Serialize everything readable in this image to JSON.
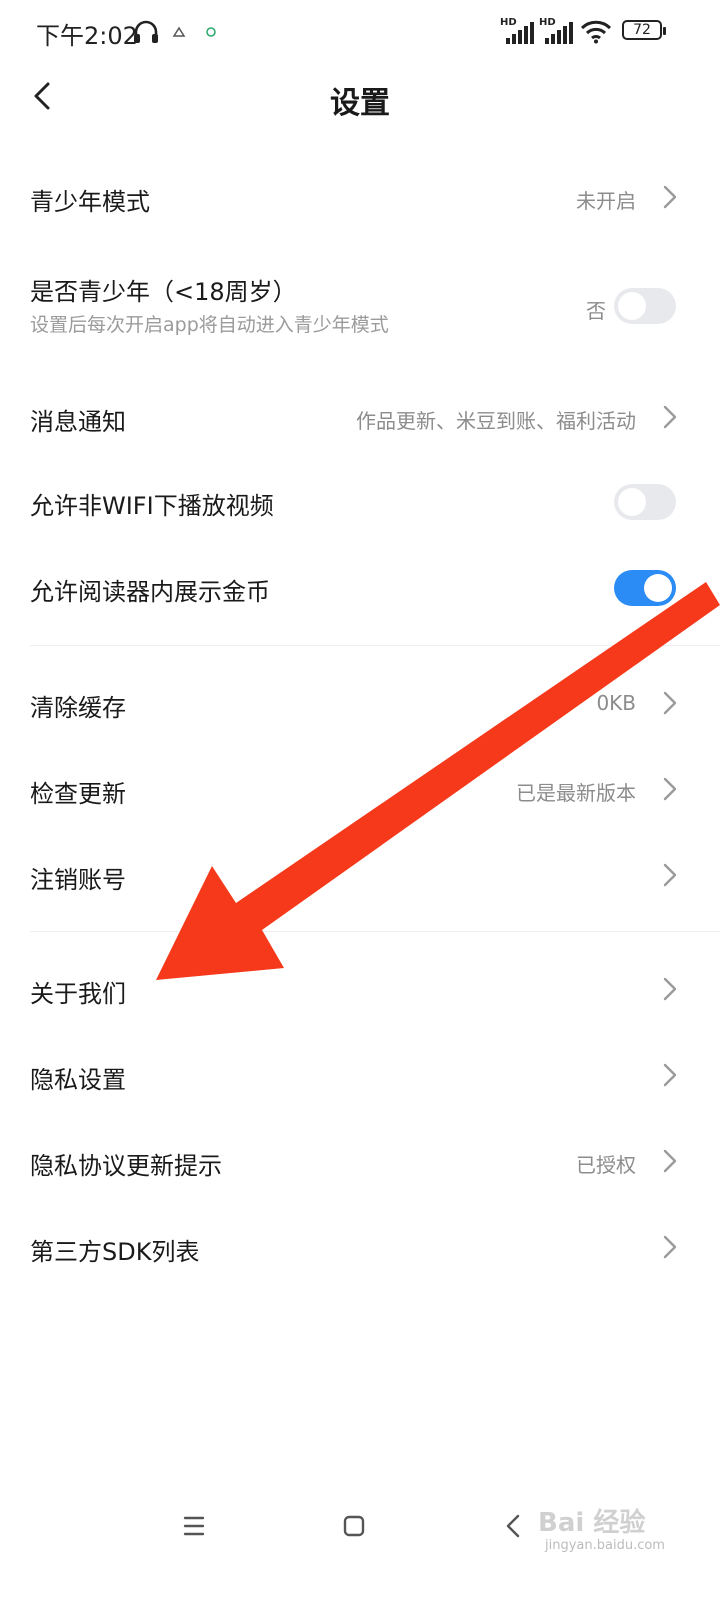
{
  "status_bar": {
    "time": "下午2:02",
    "hd1": "HD",
    "hd2": "HD",
    "battery": "72",
    "icons": [
      "headphones-icon",
      "notification-icon",
      "signal-icon",
      "wifi-icon",
      "battery-icon"
    ]
  },
  "header": {
    "title": "设置",
    "back_icon": "chevron-left-icon"
  },
  "settings": {
    "teen_mode": {
      "label": "青少年模式",
      "value": "未开启"
    },
    "is_teen": {
      "label": "是否青少年（<18周岁）",
      "subtitle": "设置后每次开启app将自动进入青少年模式",
      "value": "否",
      "toggle_on": false
    },
    "notifications": {
      "label": "消息通知",
      "value": "作品更新、米豆到账、福利活动"
    },
    "non_wifi_video": {
      "label": "允许非WIFI下播放视频",
      "toggle_on": false
    },
    "reader_coins": {
      "label": "允许阅读器内展示金币",
      "toggle_on": true
    },
    "clear_cache": {
      "label": "清除缓存",
      "value": "0KB"
    },
    "check_update": {
      "label": "检查更新",
      "value": "已是最新版本"
    },
    "delete_account": {
      "label": "注销账号"
    },
    "about_us": {
      "label": "关于我们"
    },
    "privacy_settings": {
      "label": "隐私设置"
    },
    "privacy_update": {
      "label": "隐私协议更新提示",
      "value": "已授权"
    },
    "third_party_sdk": {
      "label": "第三方SDK列表"
    }
  },
  "watermark": {
    "text": "Bai 经验",
    "sub": "jingyan.baidu.com"
  },
  "colors": {
    "accent": "#2b8cf5",
    "annotation_arrow": "#f5391a",
    "toggle_off": "#e8e9ec"
  }
}
